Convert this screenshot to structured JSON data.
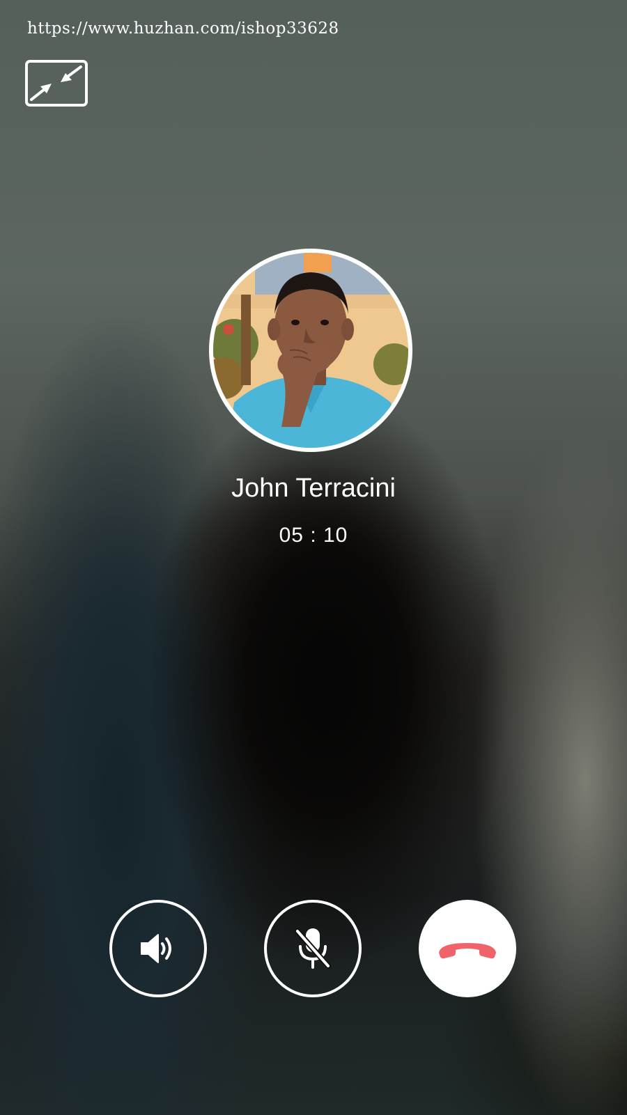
{
  "watermark": {
    "url": "https://www.huzhan.com/ishop33628"
  },
  "call": {
    "caller_name": "John Terracini",
    "duration": "05 : 10"
  },
  "controls": {
    "minimize_icon": "minimize-arrows-icon",
    "speaker_icon": "speaker-icon",
    "mute_icon": "mic-off-icon",
    "hangup_icon": "hang-up-icon",
    "hangup_color": "#f0636b"
  },
  "colors": {
    "foreground": "#ffffff",
    "hangup_background": "#ffffff",
    "hangup_accent": "#f0636b"
  }
}
